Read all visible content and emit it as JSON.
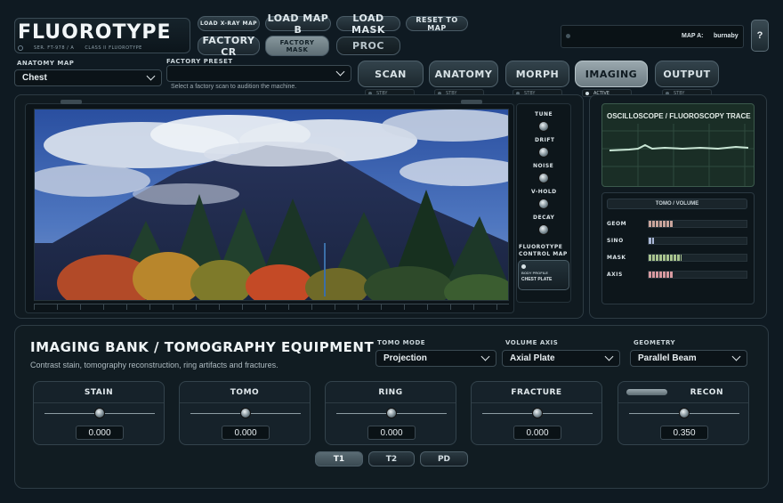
{
  "app": {
    "title": "FLUOROTYPE",
    "subtitle_left": "SER. FT-978 / A",
    "subtitle_right": "CLASS II FLUOROTYPE"
  },
  "toolbar": {
    "load_xray_map": "LOAD X-RAY MAP",
    "load_map_b": "LOAD MAP B",
    "load_mask": "LOAD MASK",
    "reset_to_map": "RESET TO MAP",
    "factory_cr": "FACTORY CR",
    "factory_mask": "FACTORY MASK",
    "proc": "PROC"
  },
  "map_display": {
    "label": "MAP A:",
    "value": "burnaby"
  },
  "help_label": "?",
  "anatomy_map": {
    "label": "ANATOMY MAP",
    "value": "Chest"
  },
  "factory_preset": {
    "label": "FACTORY PRESET",
    "value": "",
    "hint": "Select a factory scan to audition the machine."
  },
  "tabs": [
    {
      "label": "SCAN",
      "status": "STBY",
      "active": false
    },
    {
      "label": "ANATOMY",
      "status": "STBY",
      "active": false
    },
    {
      "label": "MORPH",
      "status": "STBY",
      "active": false
    },
    {
      "label": "IMAGING",
      "status": "ACTIVE",
      "active": true
    },
    {
      "label": "OUTPUT",
      "status": "STBY",
      "active": false
    }
  ],
  "knobs": [
    "TUNE",
    "DRIFT",
    "NOISE",
    "V-HOLD",
    "DECAY"
  ],
  "control_map": {
    "title_line1": "FLUOROTYPE",
    "title_line2": "CONTROL MAP",
    "profile_label": "BODY PROFILE",
    "profile_value": "CHEST PLATE"
  },
  "scope": {
    "title": "OSCILLOSCOPE / FLUOROSCOPY TRACE"
  },
  "tomo_volume": {
    "title": "TOMO / VOLUME",
    "rows": [
      {
        "label": "GEOM",
        "level": 0.25,
        "color": "#c9a59c"
      },
      {
        "label": "SINO",
        "level": 0.05,
        "color": "#aab8d8"
      },
      {
        "label": "MASK",
        "level": 0.34,
        "color": "#a9c48f"
      },
      {
        "label": "AXIS",
        "level": 0.25,
        "color": "#d79aa0"
      }
    ]
  },
  "bank": {
    "title": "IMAGING BANK / TOMOGRAPHY EQUIPMENT",
    "description": "Contrast stain, tomography reconstruction, ring artifacts and fractures.",
    "tomo_mode": {
      "label": "TOMO MODE",
      "value": "Projection"
    },
    "volume_axis": {
      "label": "VOLUME AXIS",
      "value": "Axial Plate"
    },
    "geometry": {
      "label": "GEOMETRY",
      "value": "Parallel Beam"
    },
    "modules": [
      {
        "label": "STAIN",
        "value": "0.000",
        "level": 0.0
      },
      {
        "label": "TOMO",
        "value": "0.000",
        "level": 0.0
      },
      {
        "label": "RING",
        "value": "0.000",
        "level": 0.0
      },
      {
        "label": "FRACTURE",
        "value": "0.000",
        "level": 0.0
      },
      {
        "label": "RECON",
        "value": "0.350",
        "level": 0.35
      }
    ],
    "sequences": [
      {
        "label": "T1",
        "active": true
      },
      {
        "label": "T2",
        "active": false
      },
      {
        "label": "PD",
        "active": false
      }
    ]
  }
}
